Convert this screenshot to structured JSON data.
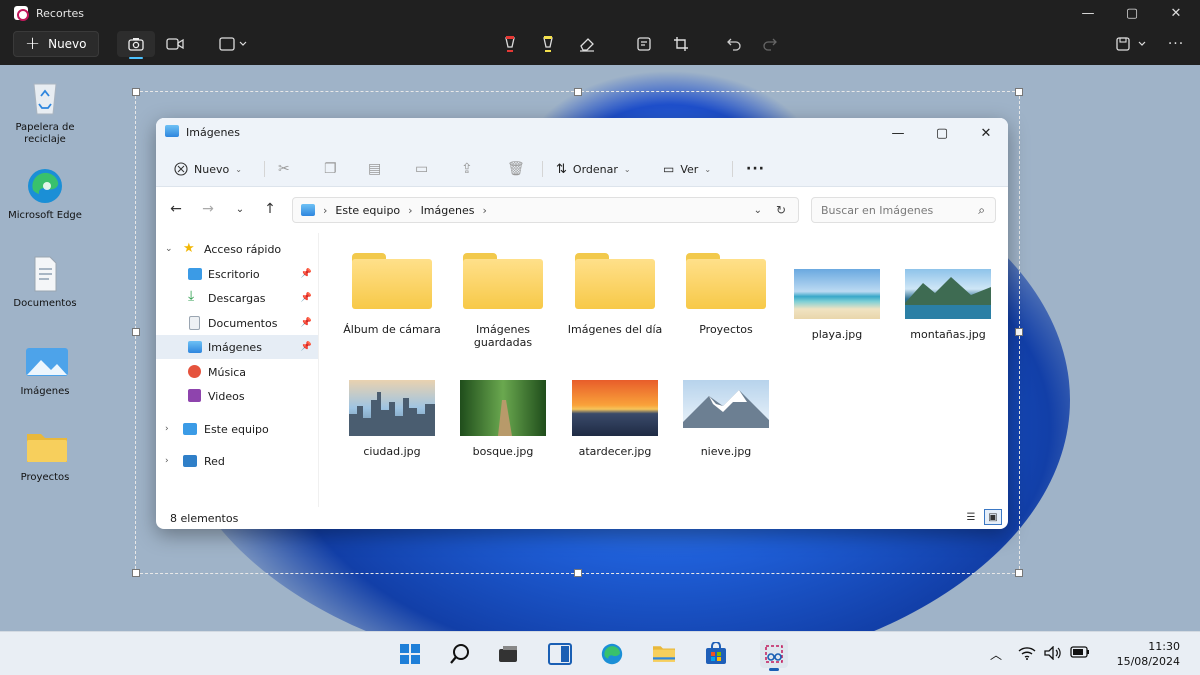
{
  "snip": {
    "title": "Recortes",
    "new_label": "Nuevo",
    "min": "—",
    "max": "▢",
    "close": "✕",
    "colors": {
      "bar": "#202020",
      "accent": "#4cc2ff"
    }
  },
  "desktop": {
    "icons": [
      {
        "label": "Papelera de reciclaje",
        "icon": "recycle-bin-icon"
      },
      {
        "label": "Microsoft Edge",
        "icon": "edge-icon"
      },
      {
        "label": "Documentos",
        "icon": "document-icon"
      },
      {
        "label": "Imágenes",
        "icon": "images-icon"
      },
      {
        "label": "Proyectos",
        "icon": "folder-icon"
      }
    ]
  },
  "explorer": {
    "title": "Imágenes",
    "cmd": {
      "new": "Nuevo",
      "sort": "Ordenar",
      "view": "Ver",
      "more": "···"
    },
    "address": {
      "root": "Este equipo",
      "current": "Imágenes"
    },
    "search_placeholder": "Buscar en Imágenes",
    "nav": [
      {
        "label": "Acceso rápido"
      },
      {
        "label": "Escritorio"
      },
      {
        "label": "Descargas"
      },
      {
        "label": "Documentos"
      },
      {
        "label": "Imágenes"
      },
      {
        "label": "Música"
      },
      {
        "label": "Videos"
      },
      {
        "label": "Este equipo"
      },
      {
        "label": "Red"
      }
    ],
    "items": [
      {
        "name": "Álbum de cámara",
        "type": "folder"
      },
      {
        "name": "Imágenes guardadas",
        "type": "folder"
      },
      {
        "name": "Imágenes del día",
        "type": "folder"
      },
      {
        "name": "Proyectos",
        "type": "folder"
      },
      {
        "name": "playa.jpg",
        "type": "image"
      },
      {
        "name": "montañas.jpg",
        "type": "image"
      },
      {
        "name": "ciudad.jpg",
        "type": "image"
      },
      {
        "name": "bosque.jpg",
        "type": "image"
      },
      {
        "name": "atardecer.jpg",
        "type": "image"
      },
      {
        "name": "nieve.jpg",
        "type": "image"
      }
    ],
    "status": "8 elementos"
  },
  "taskbar": {
    "time": "11:30",
    "date": "15/08/2024"
  }
}
